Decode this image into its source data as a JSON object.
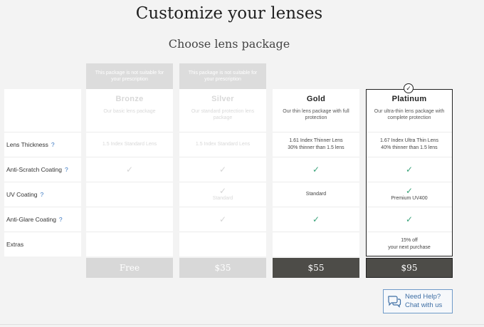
{
  "page": {
    "title": "Customize your lenses",
    "subtitle": "Choose lens package"
  },
  "features": [
    {
      "label": "Lens Thickness",
      "help": "?"
    },
    {
      "label": "Anti-Scratch Coating",
      "help": "?"
    },
    {
      "label": "UV Coating",
      "help": "?"
    },
    {
      "label": "Anti-Glare Coating",
      "help": "?"
    },
    {
      "label": "Extras",
      "help": ""
    }
  ],
  "packages": [
    {
      "name": "Bronze",
      "banner": "This package is not suitable for your prescription",
      "desc": "Our basic lens package",
      "thickness_line1": "1.5 Index Standard Lens",
      "thickness_line2": "",
      "uv_text": "",
      "extras_line1": "",
      "extras_line2": "",
      "price": "Free",
      "state": "disabled"
    },
    {
      "name": "Silver",
      "banner": "This package is not suitable for your prescription",
      "desc": "Our standard protection lens package",
      "thickness_line1": "1.5 Index Standard Lens",
      "thickness_line2": "",
      "uv_text": "Standard",
      "extras_line1": "",
      "extras_line2": "",
      "price": "$35",
      "state": "disabled"
    },
    {
      "name": "Gold",
      "banner": "",
      "desc": "Our thin lens package with full protection",
      "thickness_line1": "1.61 Index Thinner Lens",
      "thickness_line2": "30% thinner than 1.5 lens",
      "uv_text": "Standard",
      "extras_line1": "",
      "extras_line2": "",
      "price": "$55",
      "state": "available"
    },
    {
      "name": "Platinum",
      "banner": "",
      "desc": "Our ultra-thin lens package with complete protection",
      "thickness_line1": "1.67 Index Ultra Thin Lens",
      "thickness_line2": "40% thinner than 1.5 lens",
      "uv_text": "Premium UV400",
      "extras_line1": "15% off",
      "extras_line2": "your next purchase",
      "price": "$95",
      "state": "selected"
    }
  ],
  "check_glyph": "✓",
  "help": {
    "line1": "Need Help?",
    "line2": "Chat with us"
  },
  "colors": {
    "check": "#3aa37a",
    "dark_price": "#4d4c48",
    "disabled": "#d8d8d8",
    "help_blue": "#3f6fa5"
  }
}
